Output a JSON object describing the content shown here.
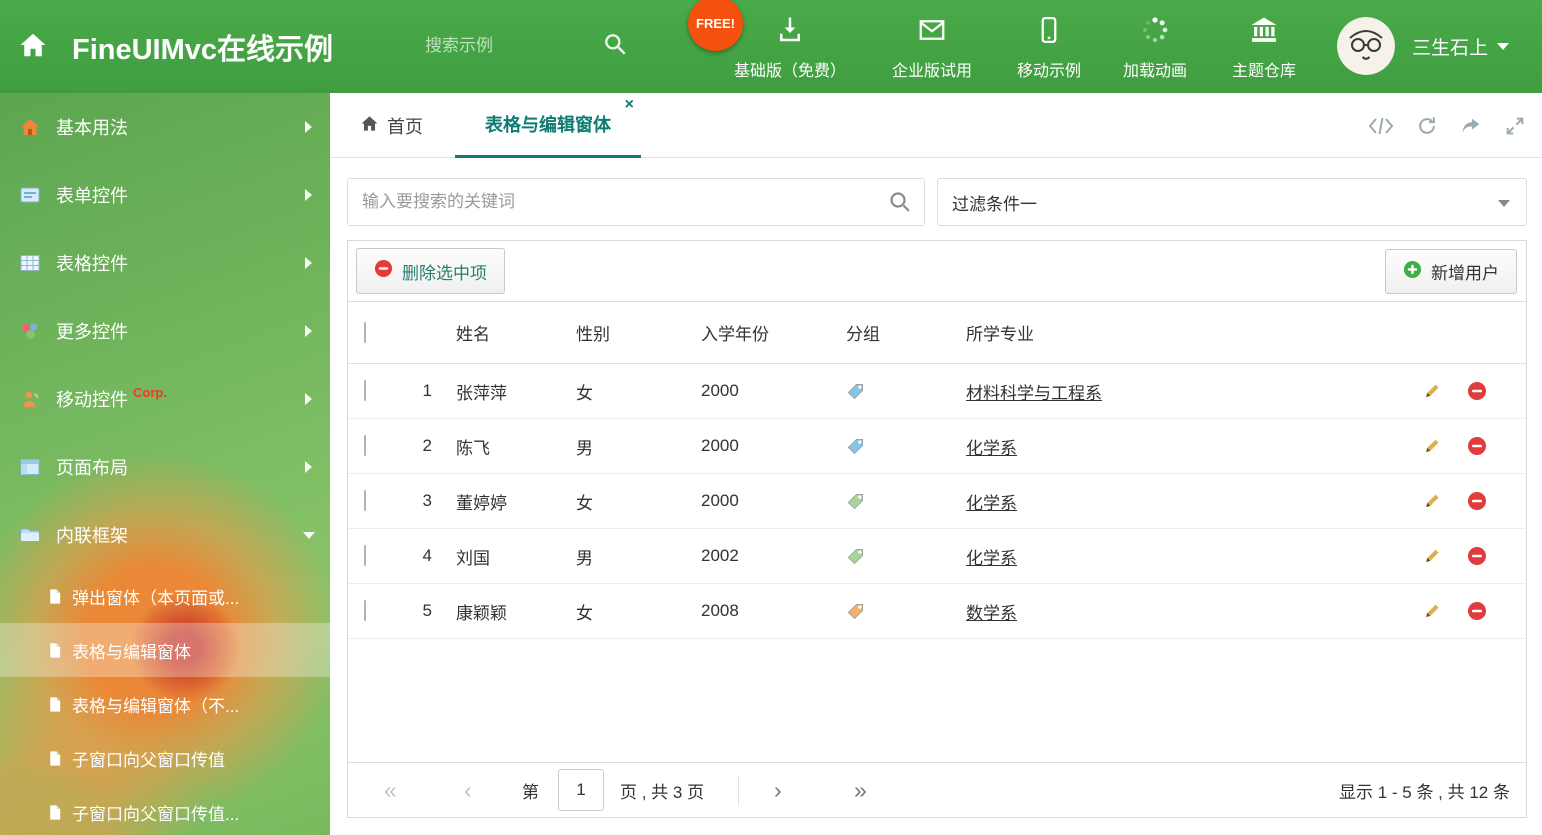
{
  "colors": {
    "header_green": "#45a245",
    "accent_teal": "#0e7c74",
    "free_badge": "#f4500e",
    "delete_red": "#e23b3b",
    "add_green": "#3fae49",
    "tag_blue": "#85c4ea",
    "tag_green": "#a8d598",
    "tag_orange": "#f3b267"
  },
  "header": {
    "title": "FineUIMvc在线示例",
    "search_placeholder": "搜索示例",
    "free_badge": "FREE!",
    "nav": [
      {
        "icon": "download-icon",
        "label": "基础版（免费）"
      },
      {
        "icon": "envelope-icon",
        "label": "企业版试用"
      },
      {
        "icon": "mobile-icon",
        "label": "移动示例"
      },
      {
        "icon": "spinner-icon",
        "label": "加载动画"
      },
      {
        "icon": "bank-icon",
        "label": "主题仓库"
      }
    ],
    "user_name": "三生石上"
  },
  "sidebar": {
    "items": [
      {
        "label": "基本用法"
      },
      {
        "label": "表单控件"
      },
      {
        "label": "表格控件"
      },
      {
        "label": "更多控件"
      },
      {
        "label": "移动控件",
        "badge": "Corp."
      },
      {
        "label": "页面布局"
      },
      {
        "label": "内联框架"
      }
    ],
    "subitems": [
      {
        "label": "弹出窗体（本页面或..."
      },
      {
        "label": "表格与编辑窗体"
      },
      {
        "label": "表格与编辑窗体（不..."
      },
      {
        "label": "子窗口向父窗口传值"
      },
      {
        "label": "子窗口向父窗口传值..."
      }
    ]
  },
  "tabs": {
    "home": "首页",
    "active": "表格与编辑窗体",
    "close_glyph": "×"
  },
  "filters": {
    "search_placeholder": "输入要搜索的关键词",
    "dropdown_value": "过滤条件一"
  },
  "toolbar": {
    "delete_label": "删除选中项",
    "add_label": "新增用户"
  },
  "table": {
    "columns": [
      "姓名",
      "性别",
      "入学年份",
      "分组",
      "所学专业"
    ],
    "rows": [
      {
        "num": "1",
        "name": "张萍萍",
        "gender": "女",
        "year": "2000",
        "tag_color": "#85c4ea",
        "major": "材料科学与工程系"
      },
      {
        "num": "2",
        "name": "陈飞",
        "gender": "男",
        "year": "2000",
        "tag_color": "#85c4ea",
        "major": "化学系"
      },
      {
        "num": "3",
        "name": "董婷婷",
        "gender": "女",
        "year": "2000",
        "tag_color": "#a8d598",
        "major": "化学系"
      },
      {
        "num": "4",
        "name": "刘国",
        "gender": "男",
        "year": "2002",
        "tag_color": "#a8d598",
        "major": "化学系"
      },
      {
        "num": "5",
        "name": "康颖颖",
        "gender": "女",
        "year": "2008",
        "tag_color": "#f3b267",
        "major": "数学系"
      }
    ]
  },
  "pagination": {
    "first_glyph": "«",
    "prev_glyph": "‹",
    "next_glyph": "›",
    "last_glyph": "»",
    "page_label_prefix": "第",
    "current_page": "1",
    "page_label_suffix": "页 , 共 3 页",
    "summary": "显示 1 - 5 条 , 共 12 条"
  }
}
